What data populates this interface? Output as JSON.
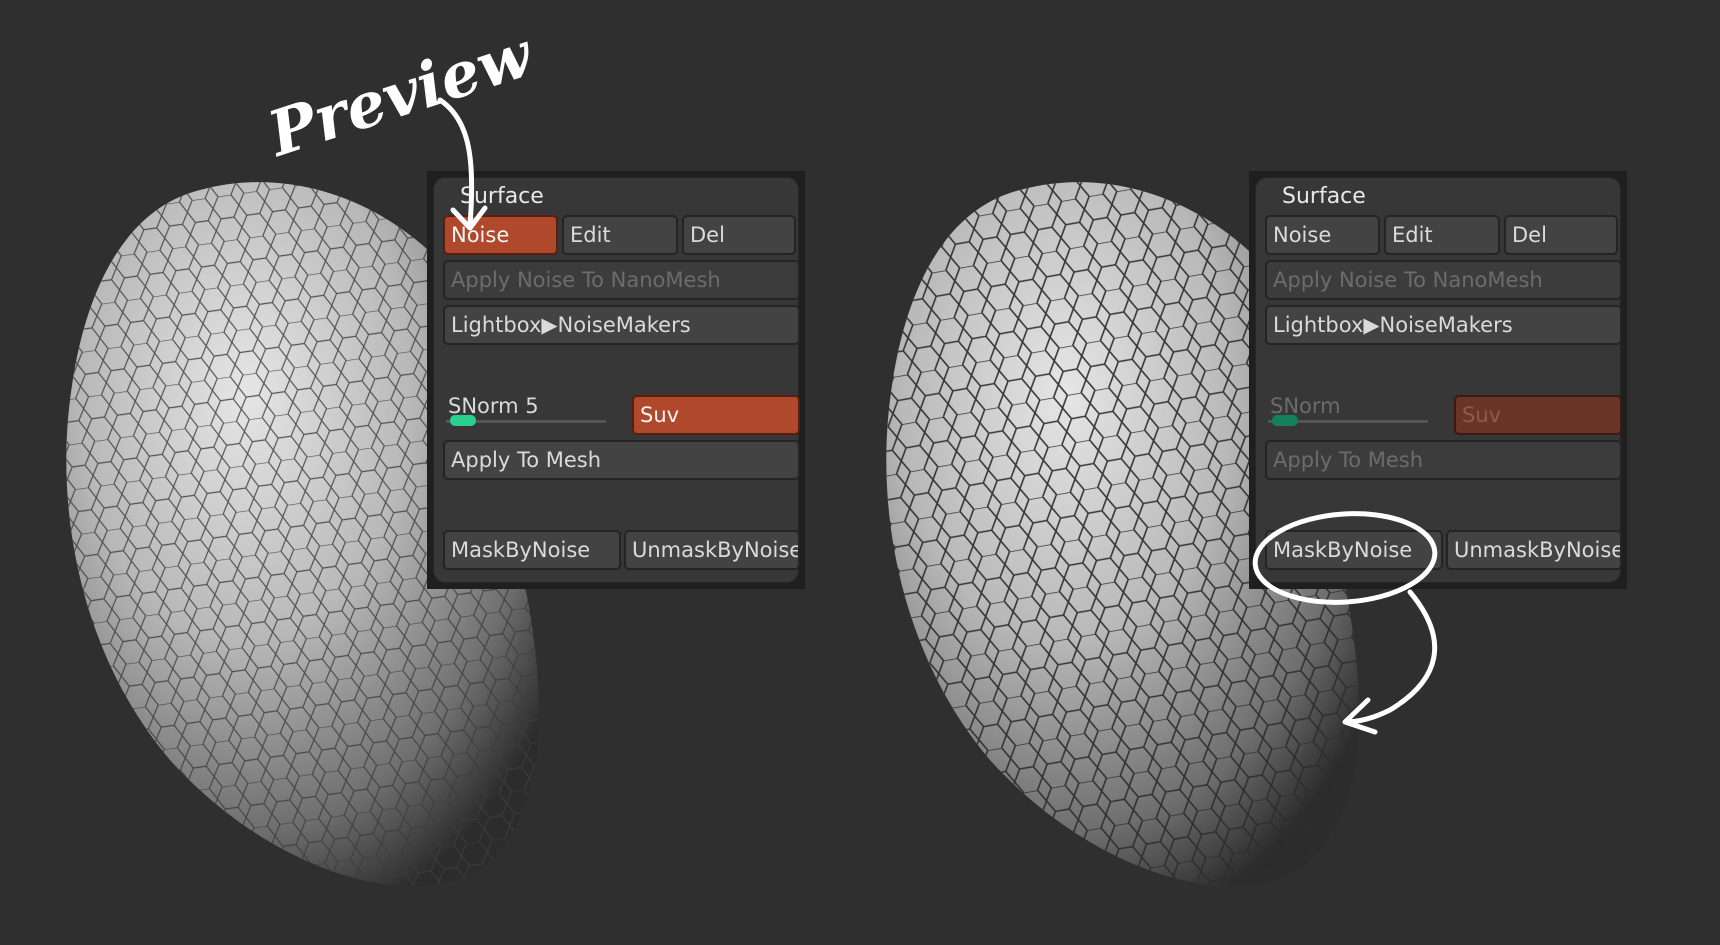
{
  "annotations": {
    "preview_label": "Preview",
    "ink_color": "#ffffff"
  },
  "panels": [
    {
      "title": "Surface",
      "noise": "Noise",
      "edit": "Edit",
      "del": "Del",
      "apply_nanomesh": "Apply Noise To NanoMesh",
      "lightbox": "Lightbox▶NoiseMakers",
      "snorm": "SNorm 5",
      "suv": "Suv",
      "apply_mesh": "Apply To Mesh",
      "mask": "MaskByNoise",
      "unmask": "UnmaskByNoise"
    },
    {
      "title": "Surface",
      "noise": "Noise",
      "edit": "Edit",
      "del": "Del",
      "apply_nanomesh": "Apply Noise To NanoMesh",
      "lightbox": "Lightbox▶NoiseMakers",
      "snorm": "SNorm",
      "suv": "Suv",
      "apply_mesh": "Apply To Mesh",
      "mask": "MaskByNoise",
      "unmask": "UnmaskByNoise"
    }
  ],
  "colors": {
    "background": "#2f2f2f",
    "active_button": "#b0482b",
    "slider_accent": "#29d08e"
  }
}
